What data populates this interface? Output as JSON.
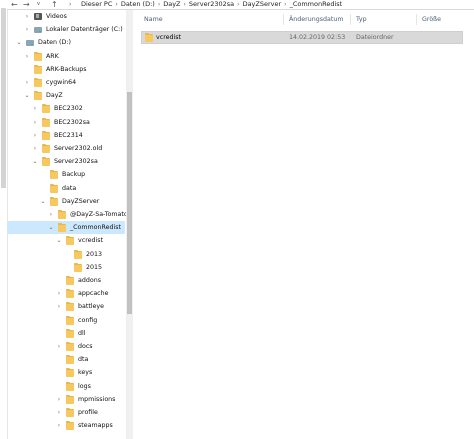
{
  "address": {
    "back_icon": "arrow-left-icon",
    "forward_icon": "arrow-right-icon",
    "recent_icon": "chevron-down-icon",
    "up_icon": "arrow-up-icon",
    "breadcrumbs": [
      "Dieser PC",
      "Daten (D:)",
      "DayZ",
      "Server2302sa",
      "DayZServer",
      "_CommonRedist"
    ]
  },
  "nav_tree": [
    {
      "label": "Videos",
      "icon": "video-icon",
      "chevron": ">"
    },
    {
      "label": "Lokaler Datenträger (C:)",
      "icon": "drive-icon",
      "chevron": ">"
    },
    {
      "label": "Daten (D:)",
      "icon": "drive-icon",
      "chevron": "v"
    },
    {
      "label": "ARK",
      "icon": "folder-icon",
      "chevron": ">"
    },
    {
      "label": "ARK-Backups",
      "icon": "folder-icon",
      "chevron": ""
    },
    {
      "label": "cygwin64",
      "icon": "folder-icon",
      "chevron": ">"
    },
    {
      "label": "DayZ",
      "icon": "folder-icon",
      "chevron": "v"
    },
    {
      "label": "BEC2302",
      "icon": "folder-icon",
      "chevron": ">"
    },
    {
      "label": "BEC2302sa",
      "icon": "folder-icon",
      "chevron": ">"
    },
    {
      "label": "BEC2314",
      "icon": "folder-icon",
      "chevron": ">"
    },
    {
      "label": "Server2302.old",
      "icon": "folder-icon",
      "chevron": ">"
    },
    {
      "label": "Server2302sa",
      "icon": "folder-icon",
      "chevron": "v"
    },
    {
      "label": "Backup",
      "icon": "folder-icon",
      "chevron": ""
    },
    {
      "label": "data",
      "icon": "folder-icon",
      "chevron": ""
    },
    {
      "label": "DayZServer",
      "icon": "folder-icon",
      "chevron": "v"
    },
    {
      "label": "@DayZ-Sa-Tomato",
      "icon": "folder-icon",
      "chevron": ">"
    },
    {
      "label": "_CommonRedist",
      "icon": "folder-icon",
      "chevron": "v",
      "selected": true
    },
    {
      "label": "vcredist",
      "icon": "folder-icon",
      "chevron": "v"
    },
    {
      "label": "2013",
      "icon": "folder-icon",
      "chevron": ""
    },
    {
      "label": "2015",
      "icon": "folder-icon",
      "chevron": ""
    },
    {
      "label": "addons",
      "icon": "folder-icon",
      "chevron": ""
    },
    {
      "label": "appcache",
      "icon": "folder-icon",
      "chevron": ">"
    },
    {
      "label": "battleye",
      "icon": "folder-icon",
      "chevron": ">"
    },
    {
      "label": "config",
      "icon": "folder-icon",
      "chevron": ""
    },
    {
      "label": "dll",
      "icon": "folder-icon",
      "chevron": ""
    },
    {
      "label": "docs",
      "icon": "folder-icon",
      "chevron": ">"
    },
    {
      "label": "dta",
      "icon": "folder-icon",
      "chevron": ""
    },
    {
      "label": "keys",
      "icon": "folder-icon",
      "chevron": ""
    },
    {
      "label": "logs",
      "icon": "folder-icon",
      "chevron": ""
    },
    {
      "label": "mpmissions",
      "icon": "folder-icon",
      "chevron": ">"
    },
    {
      "label": "profile",
      "icon": "folder-icon",
      "chevron": ">"
    },
    {
      "label": "steamapps",
      "icon": "folder-icon",
      "chevron": ">"
    }
  ],
  "columns": {
    "name": "Name",
    "date": "Änderungsdatum",
    "type": "Typ",
    "size": "Größe",
    "sort_icon": "chevron-up-icon"
  },
  "files": [
    {
      "name": "vcredist",
      "date": "14.02.2019 02:53",
      "type": "Dateiordner",
      "size": "",
      "icon": "folder-icon"
    }
  ],
  "colors": {
    "selection": "#cce8ff",
    "folder": "#f6c85f",
    "header_text": "#4c607a"
  }
}
